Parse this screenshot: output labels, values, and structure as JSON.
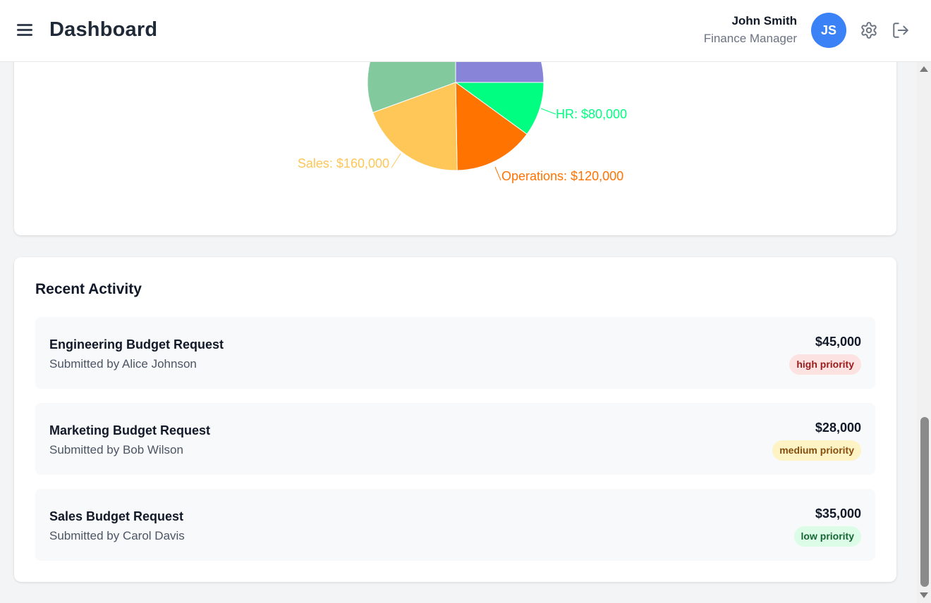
{
  "header": {
    "title": "Dashboard",
    "user_name": "John Smith",
    "user_role": "Finance Manager",
    "avatar_initials": "JS",
    "avatar_color": "#3b82f6"
  },
  "chart_data": {
    "type": "pie",
    "slices": [
      {
        "name": "",
        "label": "",
        "value": null,
        "color": "#8884d8"
      },
      {
        "name": "HR",
        "label": "HR: $80,000",
        "value": 80000,
        "color": "#00ff80"
      },
      {
        "name": "Operations",
        "label": "Operations: $120,000",
        "value": 120000,
        "color": "#ff7300"
      },
      {
        "name": "Sales",
        "label": "Sales: $160,000",
        "value": 160000,
        "color": "#ffc658"
      },
      {
        "name": "",
        "label": "",
        "value": null,
        "color": "#82ca9d"
      }
    ]
  },
  "activity": {
    "title": "Recent Activity",
    "items": [
      {
        "title": "Engineering Budget Request",
        "submitter": "Submitted by Alice Johnson",
        "amount": "$45,000",
        "priority": "high priority",
        "level": "high"
      },
      {
        "title": "Marketing Budget Request",
        "submitter": "Submitted by Bob Wilson",
        "amount": "$28,000",
        "priority": "medium priority",
        "level": "medium"
      },
      {
        "title": "Sales Budget Request",
        "submitter": "Submitted by Carol Davis",
        "amount": "$35,000",
        "priority": "low priority",
        "level": "low"
      }
    ]
  }
}
